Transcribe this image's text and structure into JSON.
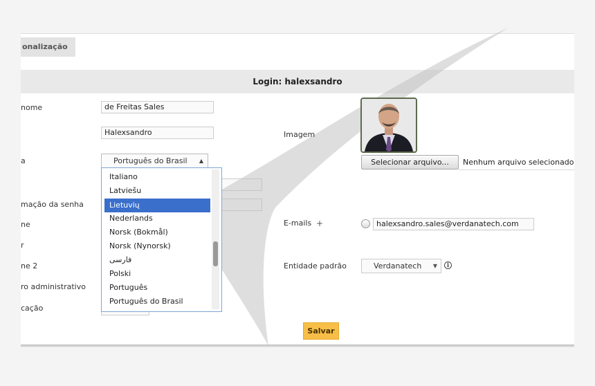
{
  "tabs": {
    "active_label": "onalização"
  },
  "header": {
    "title": "Login: halexsandro"
  },
  "form_left": {
    "labels": [
      "nome",
      "a",
      "mação da senha",
      "ne",
      "r",
      "ne 2",
      "ro administrativo",
      "cação"
    ],
    "surname_value": "de Freitas Sales",
    "firstname_value": "Halexsandro",
    "language_selected": "Português do Brasil"
  },
  "language_dropdown": {
    "options": [
      "Italiano",
      "Latviešu",
      "Lietuvių",
      "Nederlands",
      "Norsk (Bokmål)",
      "Norsk (Nynorsk)",
      "فارسی",
      "Polski",
      "Português",
      "Português do Brasil"
    ],
    "highlighted": "Lietuvių"
  },
  "form_right": {
    "image_label": "Imagem",
    "file_button_label": "Selecionar arquivo...",
    "file_status": "Nenhum arquivo selecionado",
    "emails_label": "E-mails",
    "plus_symbol": "+",
    "email_value": "halexsandro.sales@verdanatech.com",
    "entity_label": "Entidade padrão",
    "entity_value": "Verdanatech",
    "info_symbol": "i"
  },
  "actions": {
    "save_label": "Salvar"
  },
  "colors": {
    "save_button": "#f7bf48",
    "dropdown_highlight": "#3a6fcc",
    "header_bar": "#e9e9e9"
  },
  "icons": {
    "plus": "plus-icon",
    "info": "info-icon",
    "select_arrow": "triangle-icon",
    "dropdown_arrow": "chevron-down-icon"
  }
}
